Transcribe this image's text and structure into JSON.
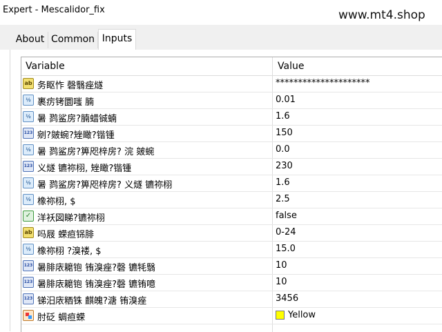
{
  "window": {
    "title": "Expert - Mescalidor_fix",
    "watermark": "www.mt4.shop"
  },
  "tabs": [
    {
      "label": "About"
    },
    {
      "label": "Common"
    },
    {
      "label": "Inputs"
    }
  ],
  "table": {
    "headers": {
      "variable": "Variable",
      "value": "Value"
    },
    "rows": [
      {
        "icon": "ab",
        "name": "务眍怍    磬翳痤燧",
        "value": "*********************"
      },
      {
        "icon": "v2",
        "name": "裹疠铐圜嗤       腩",
        "value": "0.01"
      },
      {
        "icon": "v2",
        "name": "暑    鹨鲨房?腩蜡铖蝻",
        "value": "1.6"
      },
      {
        "icon": "n123",
        "name": "剜?皴蜿?矬瞰?锴锺",
        "value": "150"
      },
      {
        "icon": "v2",
        "name": "暑    鹨鲨房?箅咫梓房?     浣 皴蜿",
        "value": "0.0"
      },
      {
        "icon": "n123",
        "name": "义燧 镳祢栩, 矬瞰?锴锺",
        "value": "230"
      },
      {
        "icon": "v2",
        "name": "暑    鹨鲨房?箅咫梓房? 义燧 镳祢栩",
        "value": "1.6"
      },
      {
        "icon": "v2",
        "name": "橡祢栩, $",
        "value": "2.5"
      },
      {
        "icon": "bool",
        "name": "洋袄図睇?镳祢栩",
        "value": "false"
      },
      {
        "icon": "ab",
        "name": "吗屐      蝾疸铞腓",
        "value": "0-24"
      },
      {
        "icon": "v2",
        "name": "橡祢栩 ?溴褛, $",
        "value": "15.0"
      },
      {
        "icon": "n123",
        "name": "暑腓庡耱铇 铕溴痤?磬 镳牦翳",
        "value": "10"
      },
      {
        "icon": "n123",
        "name": "暑腓庡耱铇 铕溴痤?磬 镳铕噫",
        "value": "10"
      },
      {
        "icon": "n123",
        "name": "锑汨庡粞铢 麒魄?溏     铕溴痤",
        "value": "3456"
      },
      {
        "icon": "color",
        "name": "肘砭  蜩疸蝾",
        "value": "Yellow",
        "swatch": "#ffff00"
      }
    ]
  },
  "icon_names": {
    "ab": "string-param-icon",
    "v2": "double-param-icon",
    "n123": "integer-param-icon",
    "bool": "bool-param-icon",
    "color": "color-param-icon"
  }
}
